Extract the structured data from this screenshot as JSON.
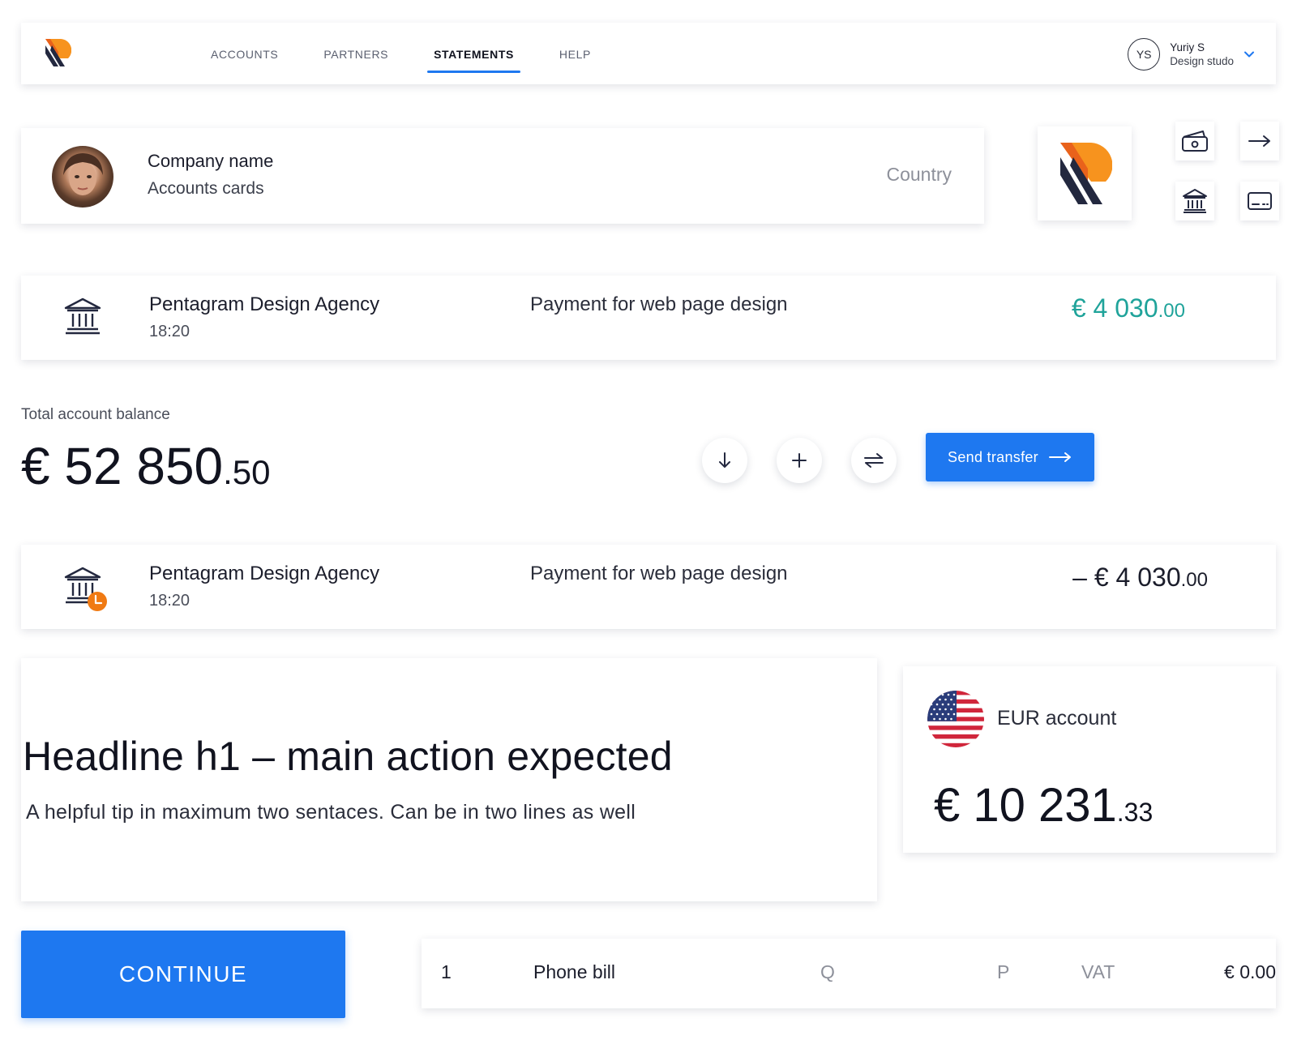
{
  "nav": {
    "tabs": [
      {
        "label": "ACCOUNTS",
        "active": false
      },
      {
        "label": "PARTNERS",
        "active": false
      },
      {
        "label": "STATEMENTS",
        "active": true
      },
      {
        "label": "HELP",
        "active": false
      }
    ],
    "user": {
      "initials": "YS",
      "name": "Yuriy S",
      "company": "Design studo"
    }
  },
  "company": {
    "title": "Company name",
    "subtitle": "Accounts cards",
    "country": "Country"
  },
  "transactions": [
    {
      "name": "Pentagram Design Agency",
      "time": "18:20",
      "description": "Payment for web page design",
      "amount_main": "€ 4 030",
      "amount_cents": ".00",
      "type": "incoming",
      "color": "#1fa39a"
    },
    {
      "name": "Pentagram Design Agency",
      "time": "18:20",
      "description": "Payment for web page design",
      "amount_main": "– € 4 030",
      "amount_cents": ".00",
      "type": "pending",
      "color": "#1b1d2b"
    }
  ],
  "balance": {
    "label": "Total account balance",
    "amount_main": "€ 52 850",
    "amount_cents": ".50"
  },
  "actions": {
    "send_transfer": "Send transfer"
  },
  "headline": {
    "title": "Headline h1 – main action expected",
    "tip": "A helpful tip in maximum two sentaces. Can be in two lines as well"
  },
  "eur_account": {
    "label": "EUR account",
    "amount_main": "€ 10 231",
    "amount_cents": ".33"
  },
  "continue_label": "CONTINUE",
  "bill": {
    "number": "1",
    "item": "Phone bill",
    "q": "Q",
    "p": "P",
    "vat": "VAT",
    "total": "€ 0.00"
  },
  "colors": {
    "accent": "#1e78f0",
    "positive": "#1fa39a",
    "pending": "#f07a13",
    "logo_orange": "#f7931e",
    "logo_navy": "#23283f"
  }
}
